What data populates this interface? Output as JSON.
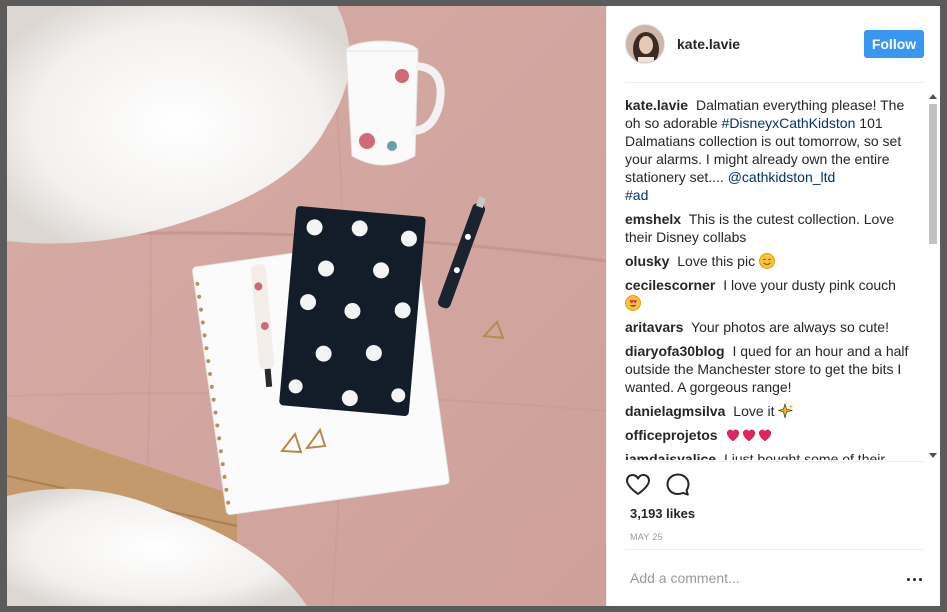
{
  "post": {
    "author": "kate.lavie",
    "follow_label": "Follow",
    "likes_text": "3,193 likes",
    "date_text": "MAY 25",
    "comment_placeholder": "Add a comment...",
    "caption": {
      "user": "kate.lavie",
      "text_1": "Dalmatian everything please! The oh so adorable",
      "hashtag_1": "#DisneyxCathKidston",
      "text_2": "101 Dalmatians collection is out tomorrow, so set your alarms. I might already own the entire stationery set....",
      "mention": "@cathkidston_ltd",
      "hashtag_2": "#ad"
    },
    "comments": [
      {
        "user": "emshelx",
        "text": "This is the cutest collection. Love their Disney collabs"
      },
      {
        "user": "olusky",
        "text": "Love this pic",
        "emoji": "smiling-face"
      },
      {
        "user": "cecilescorner",
        "text": "I love your dusty pink couch",
        "emoji": "heart-eyes-face"
      },
      {
        "user": "aritavars",
        "text": "Your photos are always so cute!"
      },
      {
        "user": "diaryofa30blog",
        "text": "I qued for an hour and a half outside the Manchester store to get the bits I wanted. A gorgeous range!"
      },
      {
        "user": "danielagmsilva",
        "text": "Love it",
        "emoji": "sparkles"
      },
      {
        "user": "officeprojetos",
        "text": "",
        "emoji": "three-red-hearts"
      },
      {
        "user": "iamdaisyalice",
        "text": "I just bought some of their"
      }
    ]
  },
  "icons": {
    "like": "heart-outline-icon",
    "comment": "speech-bubble-icon",
    "more": "ellipsis-icon"
  },
  "colors": {
    "follow_button": "#3897f0",
    "link": "#003569",
    "couch_pink": "#d9b2ab",
    "heart_red": "#e0245e"
  }
}
